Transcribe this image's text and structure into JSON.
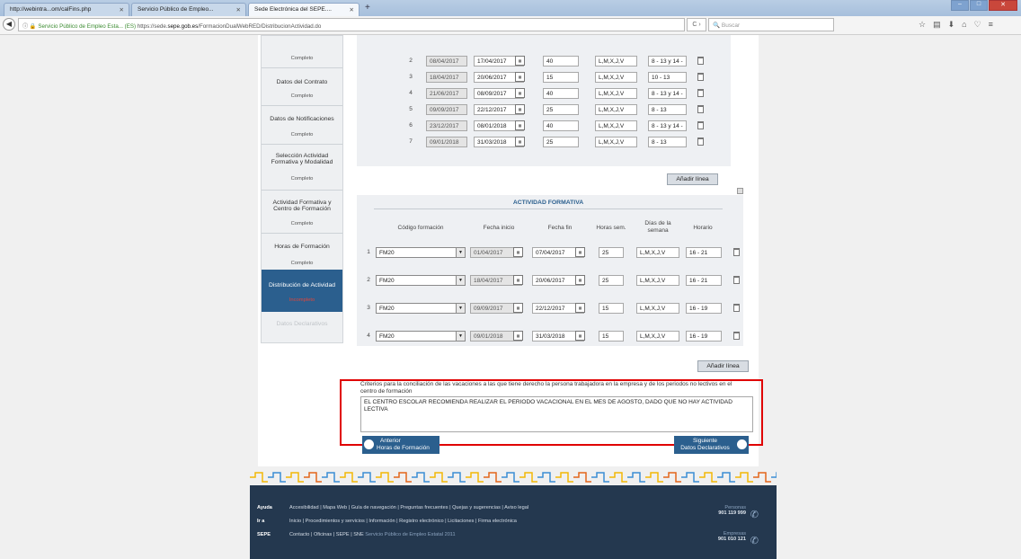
{
  "browser": {
    "tabs": [
      {
        "label": "http://webintra...om/calFins.php"
      },
      {
        "label": "Servicio Público de Empleo..."
      },
      {
        "label": "Sede Electrónica del SEPE...."
      }
    ],
    "url_site_label": "Servicio Público de Empleo Esta... (ES)",
    "url_prefix": "https://sede.",
    "url_host": "sepe.gob.es",
    "url_path": "/FormacionDualWebRED/DistribucionActividad.do",
    "search_placeholder": "Buscar"
  },
  "sidebar": {
    "items": [
      {
        "title": "",
        "status": "Completo"
      },
      {
        "title": "Datos del Contrato",
        "status": "Completo"
      },
      {
        "title": "Datos de Notificaciones",
        "status": "Completo"
      },
      {
        "title": "Selección Actividad Formativa y Modalidad",
        "status": "Completo"
      },
      {
        "title": "Actividad Formativa y Centro de Formación",
        "status": "Completo"
      },
      {
        "title": "Horas de Formación",
        "status": "Completo"
      },
      {
        "title": "Distribución de Actividad",
        "status": "Incompleto"
      },
      {
        "title": "Datos Declarativos",
        "status": ""
      }
    ]
  },
  "work_table": {
    "rows": [
      {
        "n": "2",
        "start": "08/04/2017",
        "end": "17/04/2017",
        "hours": "40",
        "days": "L,M,X,J,V",
        "schedule": "8 - 13 y 14 -"
      },
      {
        "n": "3",
        "start": "18/04/2017",
        "end": "20/06/2017",
        "hours": "15",
        "days": "L,M,X,J,V",
        "schedule": "10 - 13"
      },
      {
        "n": "4",
        "start": "21/06/2017",
        "end": "08/09/2017",
        "hours": "40",
        "days": "L,M,X,J,V",
        "schedule": "8 - 13 y 14 -"
      },
      {
        "n": "5",
        "start": "09/09/2017",
        "end": "22/12/2017",
        "hours": "25",
        "days": "L,M,X,J,V",
        "schedule": "8 - 13"
      },
      {
        "n": "6",
        "start": "23/12/2017",
        "end": "08/01/2018",
        "hours": "40",
        "days": "L,M,X,J,V",
        "schedule": "8 - 13 y 14 -"
      },
      {
        "n": "7",
        "start": "09/01/2018",
        "end": "31/03/2018",
        "hours": "25",
        "days": "L,M,X,J,V",
        "schedule": "8 - 13"
      }
    ],
    "add_line": "Añadir línea"
  },
  "training_table": {
    "title": "ACTIVIDAD FORMATIVA",
    "headers": [
      "Código formación",
      "Fecha inicio",
      "Fecha fin",
      "Horas sem.",
      "Días de la semana",
      "Horario"
    ],
    "rows": [
      {
        "n": "1",
        "code": "FM20",
        "start": "01/04/2017",
        "end": "07/04/2017",
        "hours": "25",
        "days": "L,M,X,J,V",
        "schedule": "16 - 21"
      },
      {
        "n": "2",
        "code": "FM20",
        "start": "18/04/2017",
        "end": "20/06/2017",
        "hours": "25",
        "days": "L,M,X,J,V",
        "schedule": "16 - 21"
      },
      {
        "n": "3",
        "code": "FM20",
        "start": "09/09/2017",
        "end": "22/12/2017",
        "hours": "15",
        "days": "L,M,X,J,V",
        "schedule": "16 - 19"
      },
      {
        "n": "4",
        "code": "FM20",
        "start": "09/01/2018",
        "end": "31/03/2018",
        "hours": "15",
        "days": "L,M,X,J,V",
        "schedule": "16 - 19"
      }
    ],
    "add_line": "Añadir línea"
  },
  "criteria": {
    "label": "Criterios para la conciliación de las vacaciones a las que tiene derecho la persona trabajadora en la empresa y de los periodos no lectivos en el centro de formación",
    "value": "EL CENTRO ESCOLAR RECOMIENDA REALIZAR EL PERIODO VACACIONAL EN EL MES DE AGOSTO, DADO QUE NO HAY ACTIVIDAD LECTIVA"
  },
  "nav": {
    "prev_top": "Anterior",
    "prev_bottom": "Horas de Formación",
    "next_top": "Siguiente",
    "next_bottom": "Datos Declarativos"
  },
  "footer": {
    "ayuda_label": "Ayuda",
    "ayuda_links": "Accesibilidad | Mapa Web | Guía de navegación | Preguntas frecuentes | Quejas y sugerencias | Aviso legal",
    "ira_label": "Ir a",
    "ira_links": "Inicio | Procedimientos y servicios | Información | Registro electrónico | Licitaciones | Firma electrónica",
    "sepe_label": "SEPE",
    "sepe_links": "Contacto | Oficinas | SEPE | SNE",
    "copyright": "Servicio Público de Empleo Estatal 2011",
    "phone1_label": "Personas",
    "phone1": "901 119 999",
    "phone2_label": "Empresas",
    "phone2": "901 010 121"
  },
  "colors": {
    "brand": "#2b5f8e",
    "highlight": "#e00000",
    "footer": "#24384f"
  }
}
